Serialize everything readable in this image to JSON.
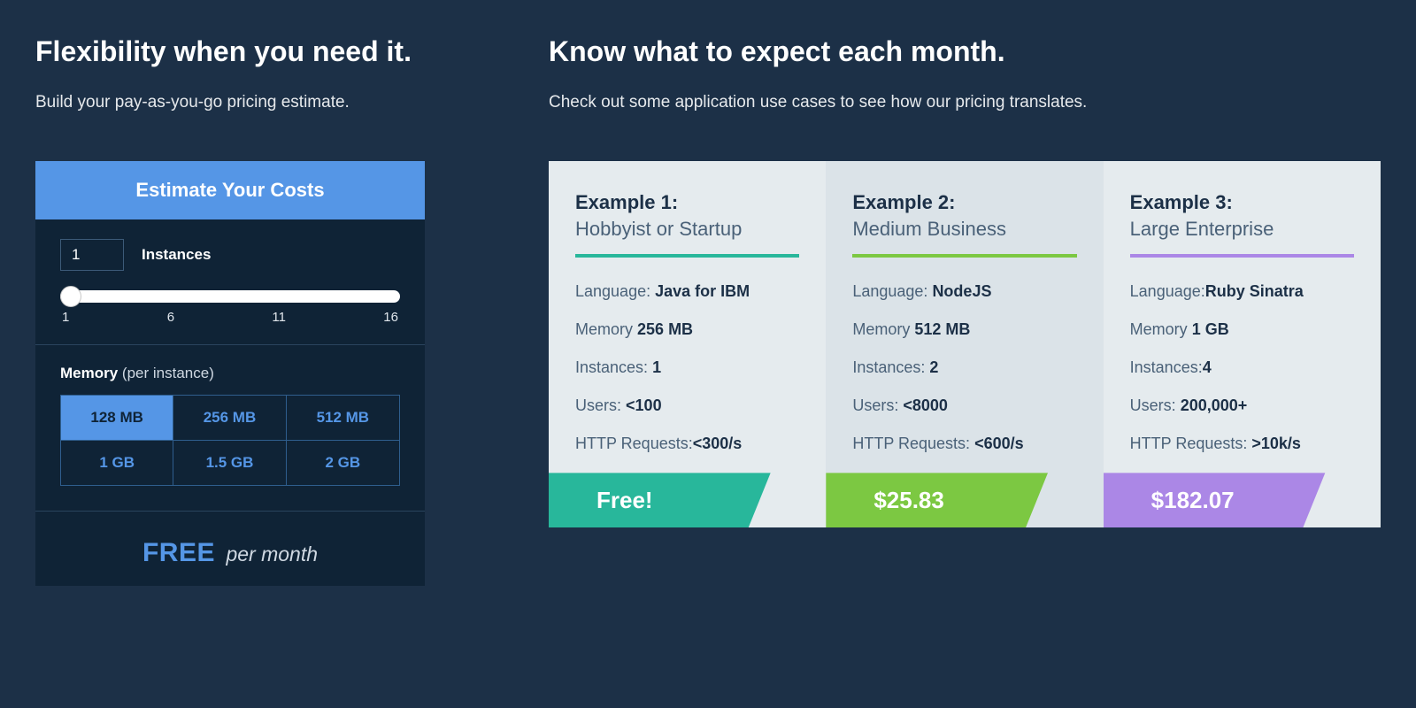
{
  "left": {
    "title": "Flexibility when you need it.",
    "subtitle": "Build your pay-as-you-go pricing estimate."
  },
  "right": {
    "title": "Know what to expect each month.",
    "subtitle": "Check out some application use cases to see how our pricing translates."
  },
  "estimator": {
    "header": "Estimate Your Costs",
    "instances_value": "1",
    "instances_label": "Instances",
    "slider_ticks": [
      "1",
      "6",
      "11",
      "16"
    ],
    "memory_label": "Memory",
    "memory_per": "(per instance)",
    "memory_options": [
      "128 MB",
      "256 MB",
      "512 MB",
      "1 GB",
      "1.5 GB",
      "2 GB"
    ],
    "memory_selected_index": 0,
    "result_price": "FREE",
    "result_suffix": "per month"
  },
  "examples": [
    {
      "title": "Example 1:",
      "subtitle": "Hobbyist or Startup",
      "language_label": "Language:",
      "language": "Java for IBM",
      "memory_label": "Memory",
      "memory": "256 MB",
      "instances_label": "Instances:",
      "instances": "1",
      "users_label": "Users:",
      "users": "<100",
      "http_label": "HTTP Requests:",
      "http": "<300/s",
      "price": "Free!"
    },
    {
      "title": "Example 2:",
      "subtitle": "Medium Business",
      "language_label": "Language:",
      "language": "NodeJS",
      "memory_label": "Memory",
      "memory": "512 MB",
      "instances_label": "Instances:",
      "instances": "2",
      "users_label": "Users:",
      "users": "<8000",
      "http_label": "HTTP Requests:",
      "http": "<600/s",
      "price": "$25.83"
    },
    {
      "title": "Example 3:",
      "subtitle": "Large Enterprise",
      "language_label": "Language:",
      "language": "Ruby Sinatra",
      "memory_label": "Memory",
      "memory": "1 GB",
      "instances_label": "Instances:",
      "instances": "4",
      "users_label": "Users:",
      "users": "200,000+",
      "http_label": "HTTP Requests:",
      "http": ">10k/s",
      "price": "$182.07"
    }
  ]
}
